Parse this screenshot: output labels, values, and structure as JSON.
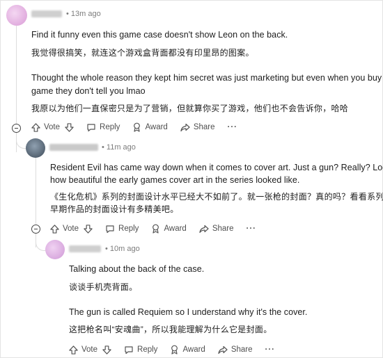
{
  "comments": [
    {
      "time": "13m ago",
      "lines": [
        "Find it funny even this game case doesn't show Leon on the back.",
        "我觉得很搞笑，就连这个游戏盒背面都没有印里昂的图案。",
        "Thought the whole reason they kept him secret was just marketing but even when you buy the",
        "game they don't tell you lmao",
        "我原以为他们一直保密只是为了营销，但就算你买了游戏，他们也不会告诉你，哈哈"
      ]
    },
    {
      "time": "11m ago",
      "lines": [
        "Resident Evil has came way down when it comes to cover art. Just a gun? Really? Look at",
        "how beautiful the early games cover art in the series looked like.",
        "《生化危机》系列的封面设计水平已经大不如前了。就一张枪的封面？真的吗？看看系列",
        "早期作品的封面设计有多精美吧。"
      ]
    },
    {
      "time": "10m ago",
      "lines": [
        "Talking about the back of the case.",
        "谈谈手机壳背面。",
        "The gun is called Requiem so I understand why it's the cover.",
        "这把枪名叫“安魂曲”，所以我能理解为什么它是封面。"
      ]
    }
  ],
  "actions": {
    "vote": "Vote",
    "reply": "Reply",
    "award": "Award",
    "share": "Share",
    "more": "···"
  },
  "colors": {
    "avatar_1": "#e7b8e6",
    "avatar_2": "#5a6b7d",
    "avatar_3": "#e0b0e4",
    "thread_line": "#dcdcdc"
  },
  "icons": [
    "upvote-icon",
    "downvote-icon",
    "reply-icon",
    "award-icon",
    "share-icon",
    "collapse-icon"
  ]
}
